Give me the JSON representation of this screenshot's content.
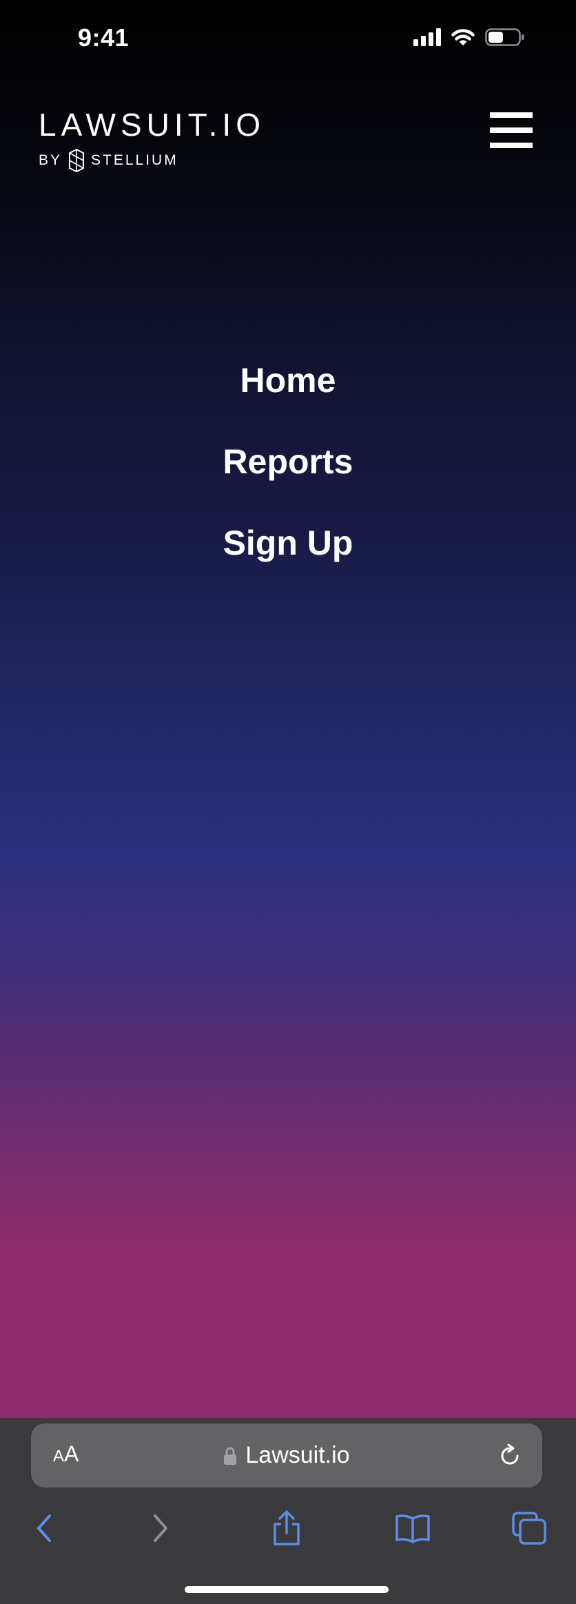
{
  "status_bar": {
    "time": "9:41"
  },
  "header": {
    "logo_title": "LAWSUIT.IO",
    "logo_by": "BY",
    "logo_company": "STELLIUM"
  },
  "nav": {
    "items": [
      {
        "label": "Home"
      },
      {
        "label": "Reports"
      },
      {
        "label": "Sign Up"
      }
    ]
  },
  "browser": {
    "text_size_small": "A",
    "text_size_big": "A",
    "url": "Lawsuit.io"
  },
  "colors": {
    "gradient_top": "#000000",
    "gradient_mid": "#2b2e7b",
    "gradient_bottom": "#8e2d6b",
    "browser_chrome": "#3a3a3c",
    "address_bar": "#636366",
    "toolbar_accent": "#5b8de8",
    "toolbar_disabled": "#8e8e93"
  },
  "icons": {
    "status": [
      "cellular-signal-icon",
      "wifi-icon",
      "battery-icon"
    ],
    "toolbar": [
      "back-icon",
      "forward-icon",
      "share-icon",
      "bookmarks-icon",
      "tabs-icon"
    ],
    "header": [
      "hamburger-menu-icon",
      "stellium-logo-icon"
    ],
    "address": [
      "lock-icon",
      "reload-icon"
    ]
  }
}
